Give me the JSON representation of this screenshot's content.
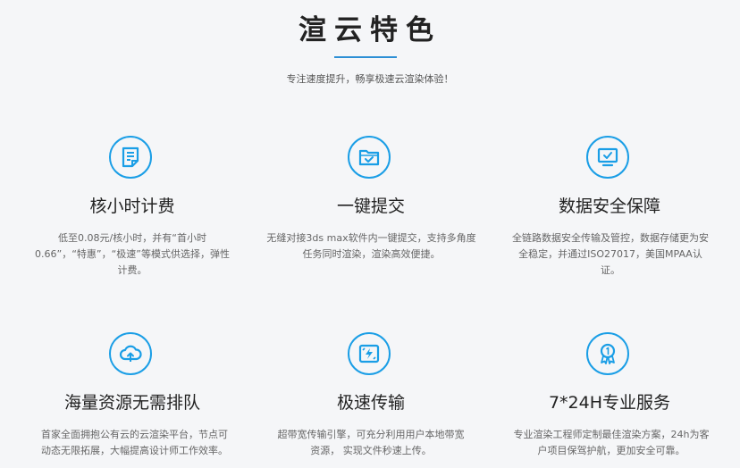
{
  "header": {
    "title": "渲云特色",
    "subtitle": "专注速度提升，畅享极速云渲染体验！"
  },
  "features": [
    {
      "title": "核小时计费",
      "desc": "低至0.08元/核小时，并有“首小时0.66”，“特惠”，“极速”等模式供选择，弹性计费。",
      "icon": "document-icon"
    },
    {
      "title": "一键提交",
      "desc": "无缝对接3ds max软件内一键提交，支持多角度任务同时渲染，渲染高效便捷。",
      "icon": "folder-check-icon"
    },
    {
      "title": "数据安全保障",
      "desc": "全链路数据安全传输及管控，数据存储更为安全稳定，并通过ISO27017，美国MPAA认证。",
      "icon": "monitor-check-icon"
    },
    {
      "title": "海量资源无需排队",
      "desc": "首家全面拥抱公有云的云渲染平台，节点可动态无限拓展，大幅提高设计师工作效率。",
      "icon": "cloud-upload-icon"
    },
    {
      "title": "极速传输",
      "desc": "超带宽传输引擎，可充分利用用户本地带宽资源， 实现文件秒速上传。",
      "icon": "lightning-sync-icon"
    },
    {
      "title": "7*24H专业服务",
      "desc": "专业渲染工程师定制最佳渲染方案，24h为客户项目保驾护航，更加安全可靠。",
      "icon": "award-medal-icon"
    }
  ],
  "colors": {
    "accent": "#1a9ee6",
    "title": "#222222",
    "text": "#666666",
    "background": "#f5f6f8"
  }
}
